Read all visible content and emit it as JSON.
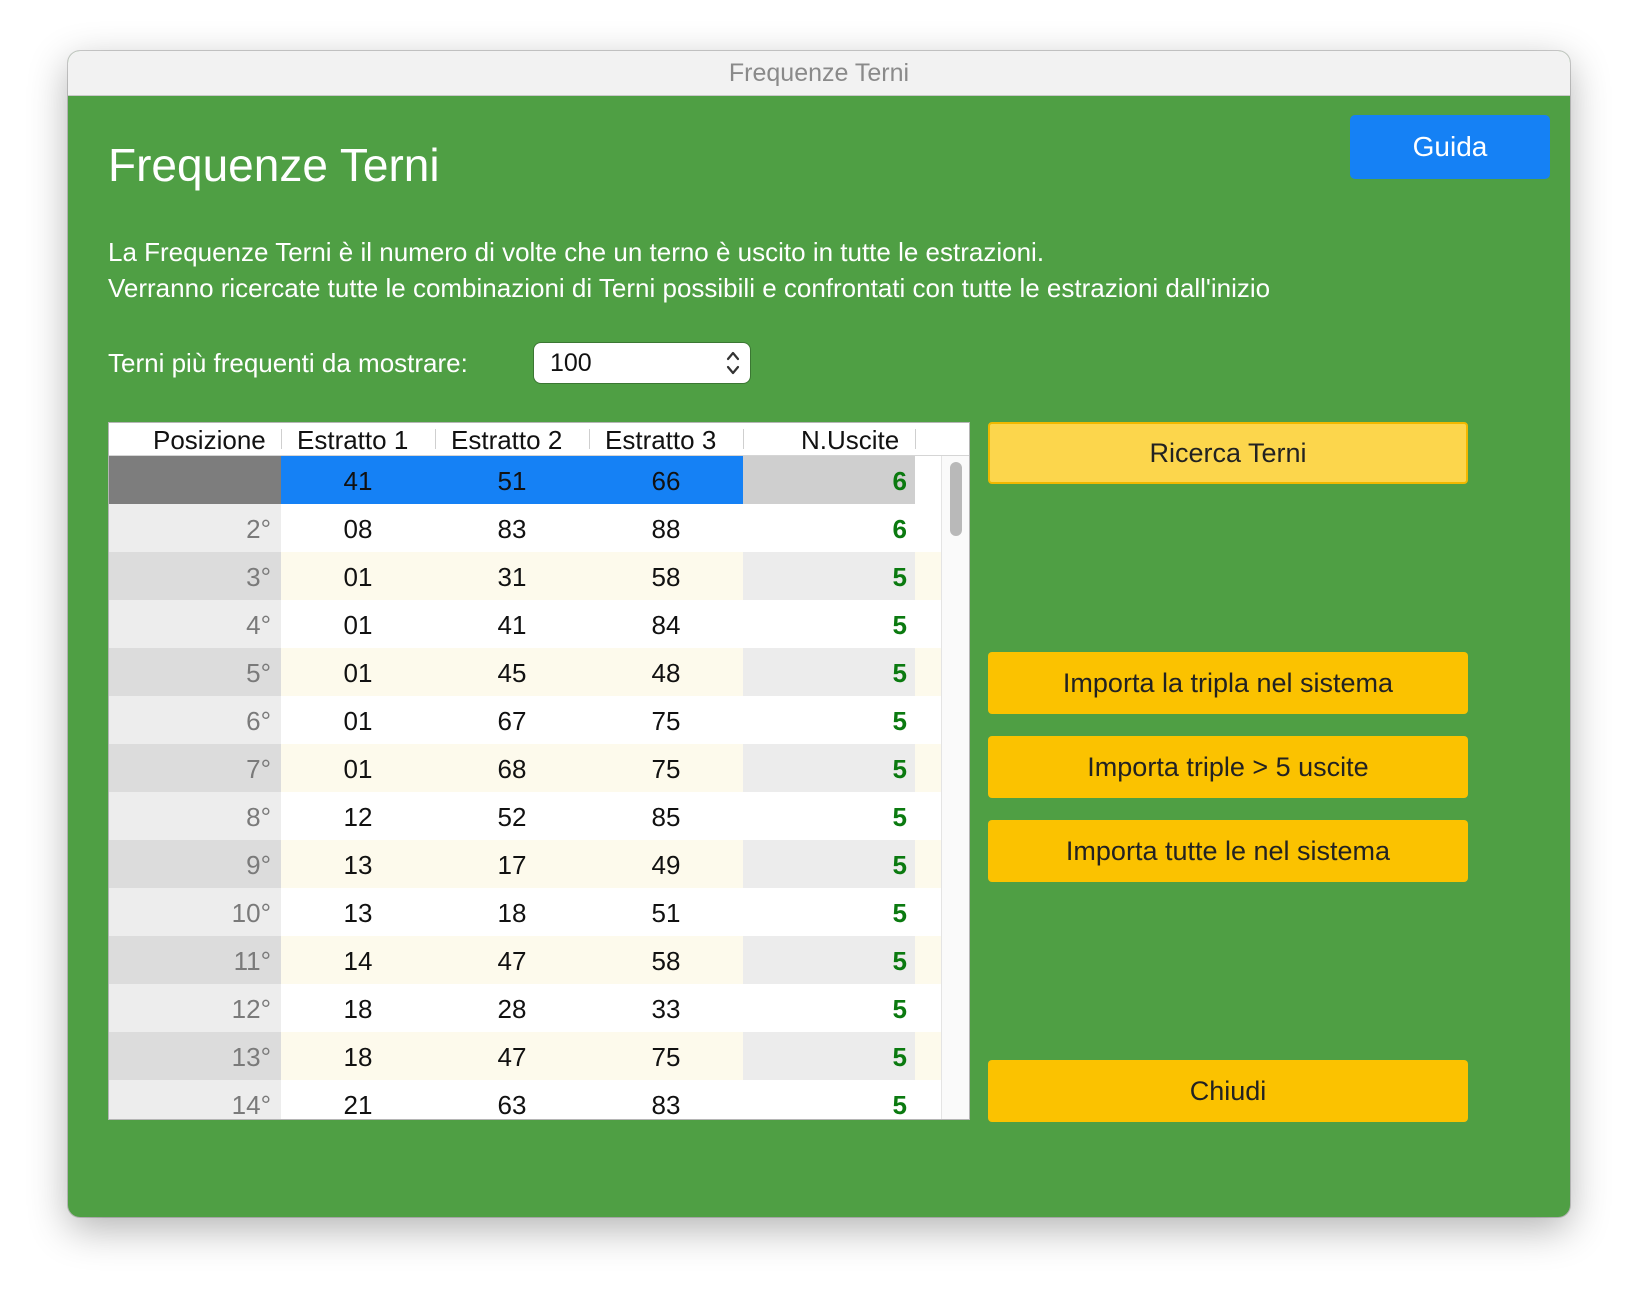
{
  "window": {
    "title": "Frequenze Terni"
  },
  "header": {
    "title": "Frequenze Terni",
    "guide_button": "Guida"
  },
  "description": {
    "line1": "La Frequenze Terni è il numero di volte che un terno è uscito in tutte le estrazioni.",
    "line2": "Verranno ricercate tutte le combinazioni di Terni possibili e confrontati con tutte le estrazioni dall'inizio"
  },
  "count_selector": {
    "label": "Terni più frequenti da mostrare:",
    "value": "100"
  },
  "table": {
    "columns": [
      "Posizione",
      "Estratto 1",
      "Estratto 2",
      "Estratto 3",
      "N.Uscite"
    ],
    "selected_row": 0,
    "rows": [
      {
        "pos": "",
        "e1": "41",
        "e2": "51",
        "e3": "66",
        "n": "6"
      },
      {
        "pos": "2°",
        "e1": "08",
        "e2": "83",
        "e3": "88",
        "n": "6"
      },
      {
        "pos": "3°",
        "e1": "01",
        "e2": "31",
        "e3": "58",
        "n": "5"
      },
      {
        "pos": "4°",
        "e1": "01",
        "e2": "41",
        "e3": "84",
        "n": "5"
      },
      {
        "pos": "5°",
        "e1": "01",
        "e2": "45",
        "e3": "48",
        "n": "5"
      },
      {
        "pos": "6°",
        "e1": "01",
        "e2": "67",
        "e3": "75",
        "n": "5"
      },
      {
        "pos": "7°",
        "e1": "01",
        "e2": "68",
        "e3": "75",
        "n": "5"
      },
      {
        "pos": "8°",
        "e1": "12",
        "e2": "52",
        "e3": "85",
        "n": "5"
      },
      {
        "pos": "9°",
        "e1": "13",
        "e2": "17",
        "e3": "49",
        "n": "5"
      },
      {
        "pos": "10°",
        "e1": "13",
        "e2": "18",
        "e3": "51",
        "n": "5"
      },
      {
        "pos": "11°",
        "e1": "14",
        "e2": "47",
        "e3": "58",
        "n": "5"
      },
      {
        "pos": "12°",
        "e1": "18",
        "e2": "28",
        "e3": "33",
        "n": "5"
      },
      {
        "pos": "13°",
        "e1": "18",
        "e2": "47",
        "e3": "75",
        "n": "5"
      },
      {
        "pos": "14°",
        "e1": "21",
        "e2": "63",
        "e3": "83",
        "n": "5"
      }
    ]
  },
  "actions": {
    "search": "Ricerca Terni",
    "import_triple": "Importa la tripla nel sistema",
    "import_over5": "Importa triple > 5 uscite",
    "import_all": "Importa tutte le nel sistema",
    "close": "Chiudi"
  },
  "colors": {
    "background": "#4f9f44",
    "guide_button": "#1581f5",
    "action_button": "#fbc200",
    "count_text": "#0b7a10"
  }
}
